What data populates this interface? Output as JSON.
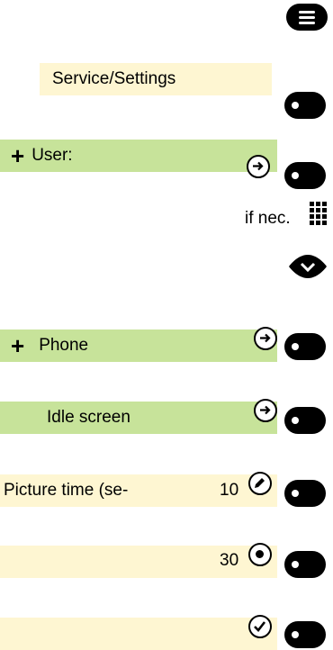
{
  "menu": {
    "service_settings": "Service/Settings",
    "user": "User:",
    "if_nec": "if nec.",
    "phone": "Phone",
    "idle_screen": "Idle screen",
    "picture_time": "Picture time (se-",
    "picture_time_value": "10",
    "option_value": "30"
  },
  "icons": {
    "plus": "+",
    "arrow_right": "→"
  },
  "colors": {
    "highlight_yellow": "#fef6d2",
    "highlight_green": "#c7e39a"
  }
}
